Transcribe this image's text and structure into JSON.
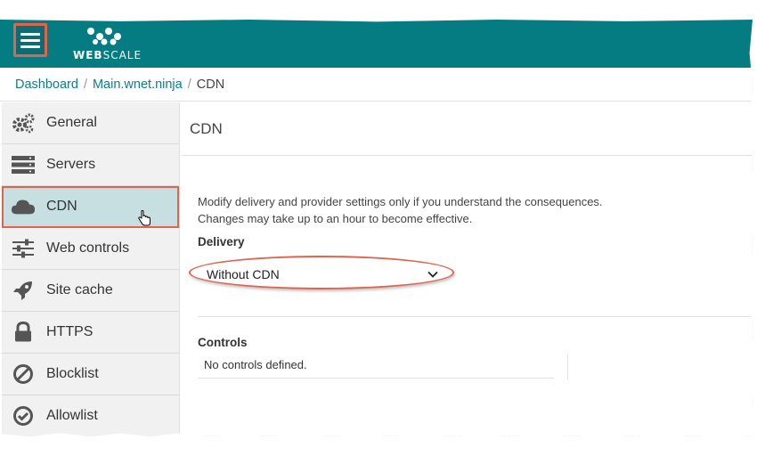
{
  "brand": {
    "logo_text_bold": "WEB",
    "logo_text_rest": "SCALE"
  },
  "breadcrumb": [
    {
      "label": "Dashboard"
    },
    {
      "label": "Main.wnet.ninja"
    },
    {
      "label": "CDN"
    }
  ],
  "sidebar": {
    "items": [
      {
        "label": "General",
        "icon": "gears-icon"
      },
      {
        "label": "Servers",
        "icon": "servers-icon"
      },
      {
        "label": "CDN",
        "icon": "cloud-icon",
        "active": true
      },
      {
        "label": "Web controls",
        "icon": "sliders-icon"
      },
      {
        "label": "Site cache",
        "icon": "rocket-icon"
      },
      {
        "label": "HTTPS",
        "icon": "lock-icon"
      },
      {
        "label": "Blocklist",
        "icon": "ban-icon"
      },
      {
        "label": "Allowlist",
        "icon": "check-circle-icon"
      }
    ]
  },
  "content": {
    "title": "CDN",
    "description_line1": "Modify delivery and provider settings only if you understand the consequences.",
    "description_line2": "Changes may take up to an hour to become effective.",
    "delivery_label": "Delivery",
    "delivery_value": "Without CDN",
    "controls_label": "Controls",
    "controls_empty": "No controls defined."
  },
  "colors": {
    "topbar": "#057b82",
    "link": "#0a7f8c",
    "highlight": "#e0634e",
    "active_bg": "#c8dfe2"
  }
}
